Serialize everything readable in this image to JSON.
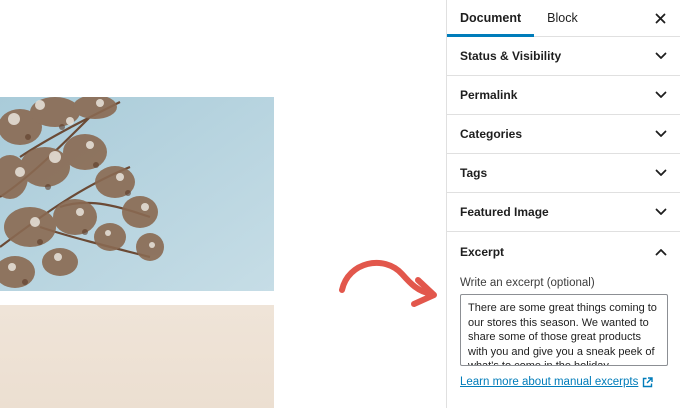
{
  "sidebar": {
    "tabs": [
      {
        "label": "Document",
        "active": true
      },
      {
        "label": "Block",
        "active": false
      }
    ],
    "close_icon": "close-icon",
    "panels": [
      {
        "title": "Status & Visibility",
        "expanded": false
      },
      {
        "title": "Permalink",
        "expanded": false
      },
      {
        "title": "Categories",
        "expanded": false
      },
      {
        "title": "Tags",
        "expanded": false
      },
      {
        "title": "Featured Image",
        "expanded": false
      },
      {
        "title": "Excerpt",
        "expanded": true
      }
    ],
    "excerpt": {
      "label": "Write an excerpt (optional)",
      "value": "There are some great things coming to our stores this season. We wanted to share some of those great products with you and give you a sneak peek of what's to come in the holiday",
      "link_text": "Learn more about manual excerpts",
      "link_icon": "external-link-icon"
    }
  },
  "colors": {
    "accent": "#007cba",
    "arrow": "#e2574c",
    "border": "#e0e0e0"
  }
}
